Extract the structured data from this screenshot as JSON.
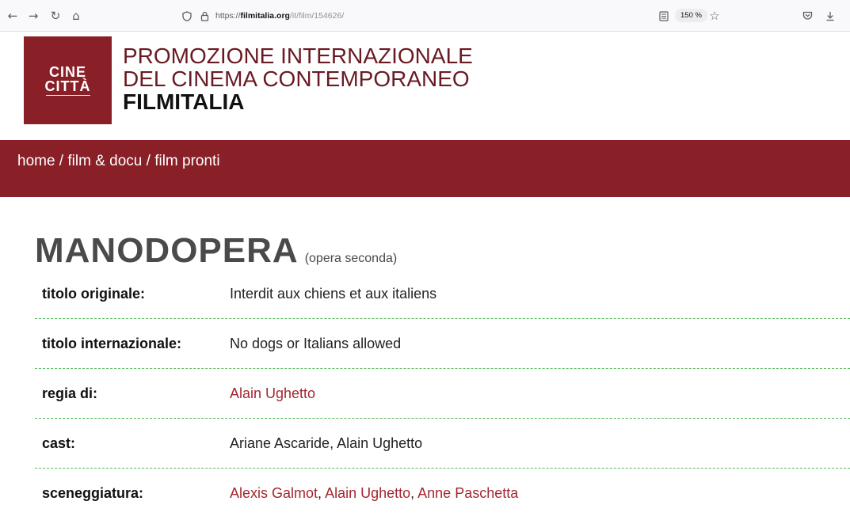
{
  "browser": {
    "url_prefix": "https://",
    "url_host": "filmitalia.org",
    "url_path": "/it/film/154626/",
    "zoom": "150 %",
    "icons": [
      "back-icon",
      "forward-icon",
      "reload-icon",
      "home-icon",
      "shield-icon",
      "lock-icon",
      "reader-view-icon",
      "bookmark-star-icon",
      "pocket-icon",
      "download-icon"
    ]
  },
  "header": {
    "logo_line1": "CINE",
    "logo_line2": "CITTÀ",
    "title_line1": "PROMOZIONE INTERNAZIONALE",
    "title_line2": "DEL CINEMA CONTEMPORANEO",
    "brand": "FILMITALIA"
  },
  "breadcrumb": {
    "home": "home",
    "sep1": " / ",
    "section": "film & docu",
    "sep2": " / ",
    "page": "film pronti"
  },
  "film": {
    "title": "MANODOPERA",
    "note": "(opera seconda)",
    "rows": [
      {
        "label": "titolo originale:",
        "value": "Interdit aux chiens et aux italiens"
      },
      {
        "label": "titolo internazionale:",
        "value": "No dogs or Italians allowed"
      },
      {
        "label": "regia di:",
        "value": "Alain Ughetto"
      },
      {
        "label": "cast:",
        "value": "Ariane Ascaride, Alain Ughetto"
      },
      {
        "label": "sceneggiatura:",
        "links": [
          "Alexis Galmot",
          "Alain Ughetto",
          "Anne Paschetta"
        ],
        "separator": ", "
      }
    ]
  },
  "colors": {
    "brand_red": "#892028",
    "link_red": "#a4262f",
    "row_divider": "#56b85a"
  }
}
